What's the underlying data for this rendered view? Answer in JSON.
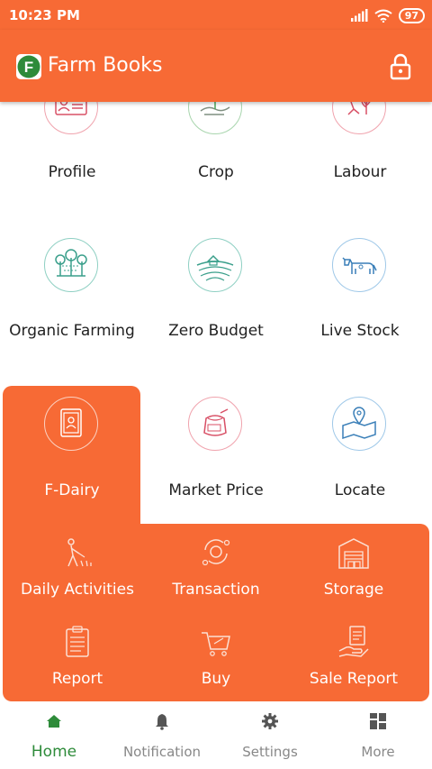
{
  "status_bar": {
    "time": "10:23 PM",
    "battery": "97"
  },
  "app_bar": {
    "title": "Farm Books",
    "logo_letter": "F"
  },
  "tiles": [
    {
      "label": "Profile"
    },
    {
      "label": "Crop"
    },
    {
      "label": "Labour"
    },
    {
      "label": "Organic Farming"
    },
    {
      "label": "Zero Budget"
    },
    {
      "label": "Live Stock"
    },
    {
      "label": "F-Dairy",
      "selected": true
    },
    {
      "label": "Market Price"
    },
    {
      "label": "Locate"
    }
  ],
  "fdairy_items": [
    {
      "label": "Daily Activities"
    },
    {
      "label": "Transaction"
    },
    {
      "label": "Storage"
    },
    {
      "label": "Report"
    },
    {
      "label": "Buy"
    },
    {
      "label": "Sale Report"
    }
  ],
  "bottom_nav": [
    {
      "label": "Home",
      "active": true
    },
    {
      "label": "Notification"
    },
    {
      "label": "Settings"
    },
    {
      "label": "More"
    }
  ],
  "colors": {
    "brand_orange": "#f76a35",
    "active_green": "#2e8b3a",
    "inactive_gray": "#888888"
  }
}
